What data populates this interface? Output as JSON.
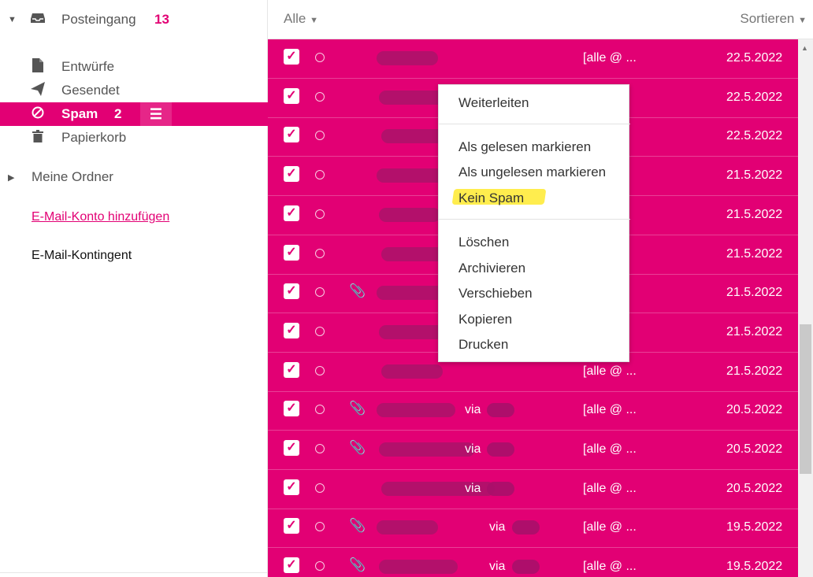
{
  "sidebar": {
    "inbox": {
      "label": "Posteingang",
      "count": "13"
    },
    "drafts": {
      "label": "Entwürfe"
    },
    "sent": {
      "label": "Gesendet"
    },
    "spam": {
      "label": "Spam",
      "count": "2"
    },
    "trash": {
      "label": "Papierkorb"
    },
    "my_folders": {
      "label": "Meine Ordner"
    },
    "add_account": "E-Mail-Konto hinzufügen",
    "quota": "E-Mail-Kontingent"
  },
  "toolbar": {
    "filter": "Alle",
    "sort": "Sortieren"
  },
  "colors": {
    "brand": "#e20074",
    "highlight": "#ffeb3b"
  },
  "rows": [
    {
      "date": "22.5.2022",
      "to": "[alle @ ...",
      "via": "",
      "attachment": false,
      "checked": true
    },
    {
      "date": "22.5.2022",
      "to": "",
      "via": "",
      "attachment": false,
      "checked": true
    },
    {
      "date": "22.5.2022",
      "to": "",
      "via": "",
      "attachment": false,
      "checked": true
    },
    {
      "date": "21.5.2022",
      "to": "",
      "via": "",
      "attachment": false,
      "checked": true
    },
    {
      "date": "21.5.2022",
      "to": "",
      "via": "",
      "attachment": false,
      "checked": true
    },
    {
      "date": "21.5.2022",
      "to": "",
      "via": "",
      "attachment": false,
      "checked": true
    },
    {
      "date": "21.5.2022",
      "to": "",
      "via": "",
      "attachment": true,
      "checked": true
    },
    {
      "date": "21.5.2022",
      "to": "",
      "via": "",
      "attachment": false,
      "checked": true
    },
    {
      "date": "21.5.2022",
      "to": "[alle @ ...",
      "via": "",
      "attachment": false,
      "checked": true
    },
    {
      "date": "20.5.2022",
      "to": "[alle @ ...",
      "via": "via",
      "attachment": true,
      "checked": true
    },
    {
      "date": "20.5.2022",
      "to": "[alle @ ...",
      "via": "via",
      "attachment": true,
      "checked": true
    },
    {
      "date": "20.5.2022",
      "to": "[alle @ ...",
      "via": "via",
      "attachment": false,
      "checked": true
    },
    {
      "date": "19.5.2022",
      "to": "[alle @ ...",
      "via": "via",
      "attachment": true,
      "checked": true
    },
    {
      "date": "19.5.2022",
      "to": "[alle @ ...",
      "via": "via",
      "attachment": true,
      "checked": true
    }
  ],
  "context_menu": {
    "forward": "Weiterleiten",
    "mark_read": "Als gelesen markieren",
    "mark_unread": "Als ungelesen markieren",
    "not_spam": "Kein Spam",
    "delete": "Löschen",
    "archive": "Archivieren",
    "move": "Verschieben",
    "copy": "Kopieren",
    "print": "Drucken"
  }
}
